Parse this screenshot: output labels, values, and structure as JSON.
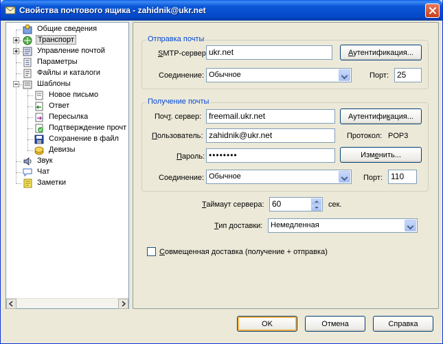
{
  "window": {
    "title": "Свойства почтового ящика - zahidnik@ukr.net"
  },
  "tree": {
    "items": [
      {
        "label": "Общие сведения",
        "icon": "general-info-icon"
      },
      {
        "label": "Транспорт",
        "icon": "transport-icon",
        "selected": true,
        "expander": "plus"
      },
      {
        "label": "Управление почтой",
        "icon": "mail-management-icon",
        "expander": "plus"
      },
      {
        "label": "Параметры",
        "icon": "parameters-icon"
      },
      {
        "label": "Файлы и каталоги",
        "icon": "files-folders-icon"
      },
      {
        "label": "Шаблоны",
        "icon": "templates-icon",
        "expander": "minus"
      },
      {
        "label": "Новое письмо",
        "icon": "new-letter-icon"
      },
      {
        "label": "Ответ",
        "icon": "reply-icon"
      },
      {
        "label": "Пересылка",
        "icon": "forward-icon"
      },
      {
        "label": "Подтверждение прочт",
        "icon": "read-receipt-icon"
      },
      {
        "label": "Сохранение в файл",
        "icon": "save-to-file-icon"
      },
      {
        "label": "Девизы",
        "icon": "mottos-icon"
      },
      {
        "label": "Звук",
        "icon": "sound-icon"
      },
      {
        "label": "Чат",
        "icon": "chat-icon"
      },
      {
        "label": "Заметки",
        "icon": "notes-icon"
      }
    ]
  },
  "send": {
    "group_title": "Отправка почты",
    "smtp_label_u": "S",
    "smtp_label_rest": "MTP-сервер:",
    "smtp_value": "ukr.net",
    "auth_button_u": "А",
    "auth_button_rest": "утентификация...",
    "conn_label": "Соединение:",
    "conn_value": "Обычное",
    "port_label": "Порт:",
    "port_value": "25"
  },
  "receive": {
    "group_title": "Получение почты",
    "server_label_a": "Поч",
    "server_label_u": "т",
    "server_label_b": ". сервер:",
    "server_value": "freemail.ukr.net",
    "auth_button_a": "Аутентифи",
    "auth_button_u": "к",
    "auth_button_b": "ация...",
    "user_label_u": "П",
    "user_label_rest": "ользователь:",
    "user_value": "zahidnik@ukr.net",
    "protocol_label": "Протокол:",
    "protocol_value": "POP3",
    "password_label_u": "П",
    "password_label_rest": "ароль:",
    "password_value": "••••••••",
    "change_button_a": "Изм",
    "change_button_u": "е",
    "change_button_b": "нить...",
    "conn_label": "Соединение:",
    "conn_value": "Обычное",
    "port_label": "Порт:",
    "port_value": "110"
  },
  "timeout": {
    "label_u": "Т",
    "label_rest": "аймаут сервера:",
    "value": "60",
    "unit": "сек."
  },
  "delivery": {
    "label_u": "Т",
    "label_rest": "ип доставки:",
    "value": "Немедленная"
  },
  "combined": {
    "label_u": "С",
    "label_rest": "овмещенная доставка (получение + отправка)",
    "checked": false
  },
  "footer": {
    "ok": "OK",
    "cancel": "Отмена",
    "help": "Справка"
  }
}
